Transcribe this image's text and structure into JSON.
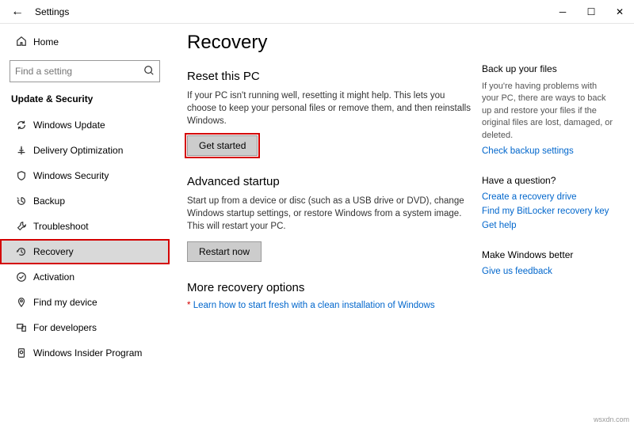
{
  "titlebar": {
    "title": "Settings"
  },
  "sidebar": {
    "home": "Home",
    "search_placeholder": "Find a setting",
    "category": "Update & Security",
    "items": [
      {
        "label": "Windows Update"
      },
      {
        "label": "Delivery Optimization"
      },
      {
        "label": "Windows Security"
      },
      {
        "label": "Backup"
      },
      {
        "label": "Troubleshoot"
      },
      {
        "label": "Recovery"
      },
      {
        "label": "Activation"
      },
      {
        "label": "Find my device"
      },
      {
        "label": "For developers"
      },
      {
        "label": "Windows Insider Program"
      }
    ]
  },
  "page": {
    "title": "Recovery",
    "reset": {
      "heading": "Reset this PC",
      "body": "If your PC isn't running well, resetting it might help. This lets you choose to keep your personal files or remove them, and then reinstalls Windows.",
      "button": "Get started"
    },
    "advanced": {
      "heading": "Advanced startup",
      "body": "Start up from a device or disc (such as a USB drive or DVD), change Windows startup settings, or restore Windows from a system image. This will restart your PC.",
      "button": "Restart now"
    },
    "more": {
      "heading": "More recovery options",
      "link": "Learn how to start fresh with a clean installation of Windows"
    }
  },
  "aside": {
    "backup": {
      "heading": "Back up your files",
      "body": "If you're having problems with your PC, there are ways to back up and restore your files if the original files are lost, damaged, or deleted.",
      "link": "Check backup settings"
    },
    "question": {
      "heading": "Have a question?",
      "links": [
        "Create a recovery drive",
        "Find my BitLocker recovery key",
        "Get help"
      ]
    },
    "better": {
      "heading": "Make Windows better",
      "link": "Give us feedback"
    }
  },
  "watermark": "wsxdn.com"
}
